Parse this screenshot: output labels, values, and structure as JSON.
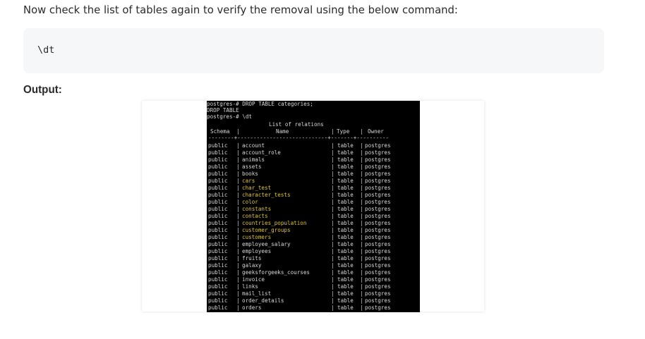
{
  "intro_text": "Now check the list of tables again to verify the removal using the below command:",
  "code": "\\dt",
  "output_label": "Output:",
  "terminal": {
    "lines": [
      "postgres-# DROP TABLE categories;",
      "DROP TABLE",
      "postgres-# \\dt"
    ],
    "list_title": "List of relations",
    "headers": {
      "schema": "Schema",
      "name": "Name",
      "type": "Type",
      "owner": "Owner"
    },
    "divider": "--------+----------------------------+-------+----------",
    "rows": [
      {
        "schema": "public",
        "name": "account",
        "type": "table",
        "owner": "postgres",
        "highlight": false
      },
      {
        "schema": "public",
        "name": "account_role",
        "type": "table",
        "owner": "postgres",
        "highlight": false
      },
      {
        "schema": "public",
        "name": "animals",
        "type": "table",
        "owner": "postgres",
        "highlight": false
      },
      {
        "schema": "public",
        "name": "assets",
        "type": "table",
        "owner": "postgres",
        "highlight": false
      },
      {
        "schema": "public",
        "name": "books",
        "type": "table",
        "owner": "postgres",
        "highlight": false
      },
      {
        "schema": "public",
        "name": "cars",
        "type": "table",
        "owner": "postgres",
        "highlight": true
      },
      {
        "schema": "public",
        "name": "char_test",
        "type": "table",
        "owner": "postgres",
        "highlight": true
      },
      {
        "schema": "public",
        "name": "character_tests",
        "type": "table",
        "owner": "postgres",
        "highlight": true
      },
      {
        "schema": "public",
        "name": "color",
        "type": "table",
        "owner": "postgres",
        "highlight": true
      },
      {
        "schema": "public",
        "name": "constants",
        "type": "table",
        "owner": "postgres",
        "highlight": true
      },
      {
        "schema": "public",
        "name": "contacts",
        "type": "table",
        "owner": "postgres",
        "highlight": true
      },
      {
        "schema": "public",
        "name": "countries_population",
        "type": "table",
        "owner": "postgres",
        "highlight": true
      },
      {
        "schema": "public",
        "name": "customer_groups",
        "type": "table",
        "owner": "postgres",
        "highlight": true
      },
      {
        "schema": "public",
        "name": "customers",
        "type": "table",
        "owner": "postgres",
        "highlight": true
      },
      {
        "schema": "public",
        "name": "employee_salary",
        "type": "table",
        "owner": "postgres",
        "highlight": false
      },
      {
        "schema": "public",
        "name": "employees",
        "type": "table",
        "owner": "postgres",
        "highlight": false
      },
      {
        "schema": "public",
        "name": "fruits",
        "type": "table",
        "owner": "postgres",
        "highlight": false
      },
      {
        "schema": "public",
        "name": "galaxy",
        "type": "table",
        "owner": "postgres",
        "highlight": false
      },
      {
        "schema": "public",
        "name": "geeksforgeeks_courses",
        "type": "table",
        "owner": "postgres",
        "highlight": false
      },
      {
        "schema": "public",
        "name": "invoice",
        "type": "table",
        "owner": "postgres",
        "highlight": false
      },
      {
        "schema": "public",
        "name": "links",
        "type": "table",
        "owner": "postgres",
        "highlight": false
      },
      {
        "schema": "public",
        "name": "mail_list",
        "type": "table",
        "owner": "postgres",
        "highlight": false
      },
      {
        "schema": "public",
        "name": "order_details",
        "type": "table",
        "owner": "postgres",
        "highlight": false
      },
      {
        "schema": "public",
        "name": "orders",
        "type": "table",
        "owner": "postgres",
        "highlight": false
      }
    ]
  },
  "colors": {
    "terminal_bg": "#000000",
    "terminal_text": "#d0d0d0",
    "highlight_text": "#e0c530",
    "code_bg": "#f6f7f9"
  }
}
